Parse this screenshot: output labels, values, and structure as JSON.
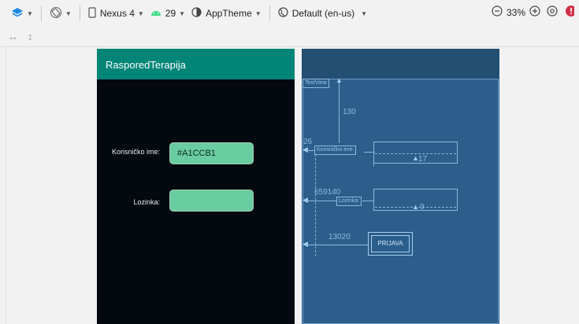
{
  "toolbar": {
    "device": "Nexus 4",
    "api_level": "29",
    "theme": "AppTheme",
    "locale": "Default (en-us)",
    "zoom": "33%"
  },
  "app": {
    "title": "RasporedTerapija",
    "username_label": "Korisničko ime:",
    "username_value": "#A1CCB1",
    "password_label": "Lozinka:",
    "password_value": ""
  },
  "blueprint": {
    "textview_label": "TextView",
    "margin_top": "130",
    "margin_26": "26",
    "username_label": "Korisničko ime:",
    "margin_17": "17",
    "margin_mixed": "6​5​9​140",
    "password_label": "Lozinka:",
    "margin_9": "9",
    "margin_button": "13020",
    "button_label": "PRIJAVA"
  },
  "colors": {
    "app_bar": "#008577",
    "field_fill": "#6acca1",
    "blueprint_bg": "#2c5e8c",
    "error_badge": "#d0304a"
  }
}
